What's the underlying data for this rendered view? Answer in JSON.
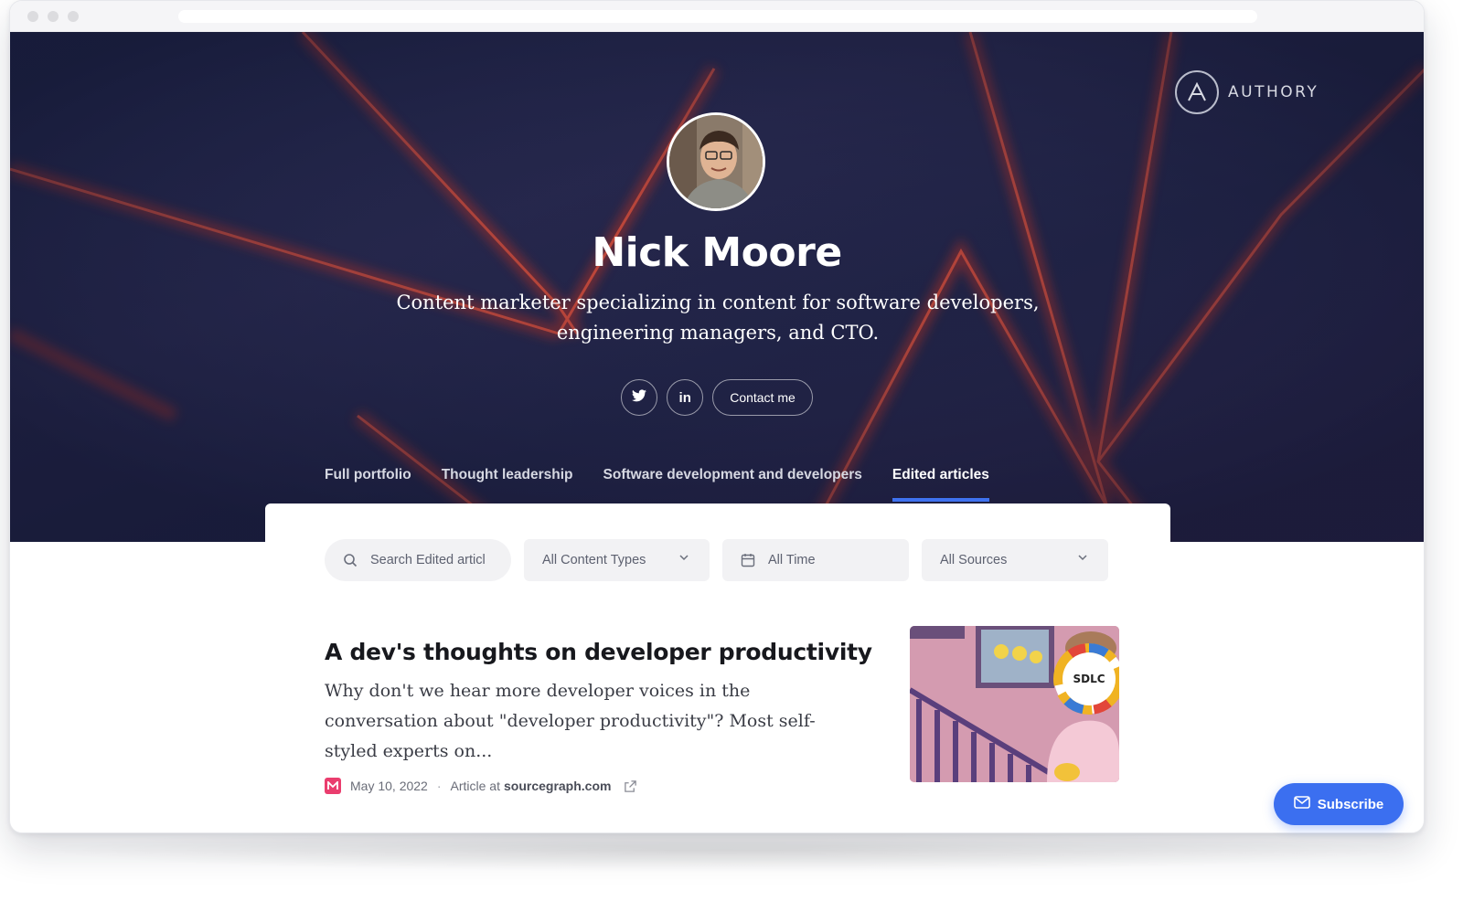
{
  "brand": {
    "name": "AUTHORY",
    "logo_letter": "A"
  },
  "profile": {
    "name": "Nick Moore",
    "bio": "Content marketer specializing in content for software developers, engineering managers, and CTO."
  },
  "social": {
    "twitter_icon": "twitter-icon",
    "linkedin_label": "in",
    "contact_label": "Contact me"
  },
  "tabs": [
    {
      "label": "Full portfolio",
      "active": false
    },
    {
      "label": "Thought leadership",
      "active": false
    },
    {
      "label": "Software development and developers",
      "active": false
    },
    {
      "label": "Edited articles",
      "active": true
    }
  ],
  "filters": {
    "search_placeholder": "Search Edited articl",
    "content_types": "All Content Types",
    "time": "All Time",
    "sources": "All Sources"
  },
  "article": {
    "title": "A dev's thoughts on developer productivity",
    "excerpt": "Why don't we hear more developer voices in the conversation about \"developer productivity\"? Most self-styled experts on...",
    "date": "May 10, 2022",
    "type_prefix": "Article at",
    "source": "sourcegraph.com",
    "thumb_badge": "SDLC"
  },
  "subscribe_label": "Subscribe",
  "colors": {
    "accent": "#3f72f0",
    "hero_bg": "#1f2244",
    "source_logo": "#ea3d6e"
  }
}
